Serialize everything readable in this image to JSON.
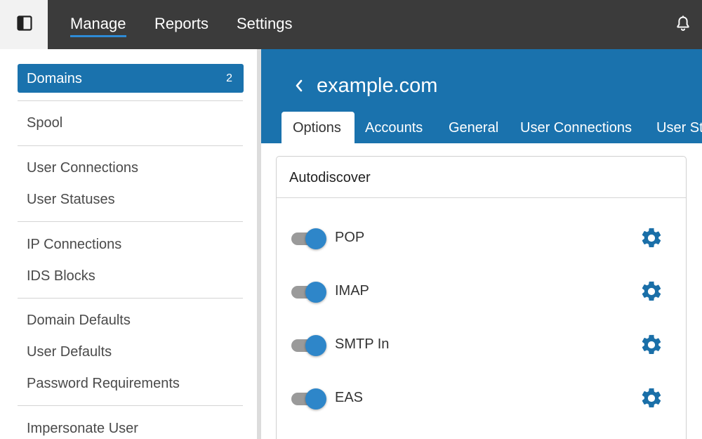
{
  "colors": {
    "topbar_bg": "#3b3b3b",
    "accent": "#1a72ad",
    "toggle_on": "#2e86c9",
    "gear": "#1a6fa8"
  },
  "topbar": {
    "panel_icon": "sidebar-toggle-icon",
    "nav": [
      {
        "label": "Manage",
        "active": true
      },
      {
        "label": "Reports",
        "active": false
      },
      {
        "label": "Settings",
        "active": false
      }
    ],
    "bell_icon": "bell-icon"
  },
  "sidebar": {
    "active_item": {
      "label": "Domains",
      "count": "2"
    },
    "groups": [
      [
        "Spool"
      ],
      [
        "User Connections",
        "User Statuses"
      ],
      [
        "IP Connections",
        "IDS Blocks"
      ],
      [
        "Domain Defaults",
        "User Defaults",
        "Password Requirements"
      ],
      [
        "Impersonate User"
      ]
    ]
  },
  "header": {
    "back_icon": "chevron-left-icon",
    "title": "example.com",
    "tabs": [
      {
        "label": "Options",
        "active": true
      },
      {
        "label": "Accounts",
        "active": false
      },
      {
        "label": "General",
        "active": false
      },
      {
        "label": "User Connections",
        "active": false
      },
      {
        "label": "User St",
        "active": false
      }
    ]
  },
  "card": {
    "title": "Autodiscover",
    "rows": [
      {
        "label": "POP",
        "enabled": true,
        "icon": "gear-icon"
      },
      {
        "label": "IMAP",
        "enabled": true,
        "icon": "gear-icon"
      },
      {
        "label": "SMTP In",
        "enabled": true,
        "icon": "gear-icon"
      },
      {
        "label": "EAS",
        "enabled": true,
        "icon": "gear-icon"
      }
    ]
  }
}
